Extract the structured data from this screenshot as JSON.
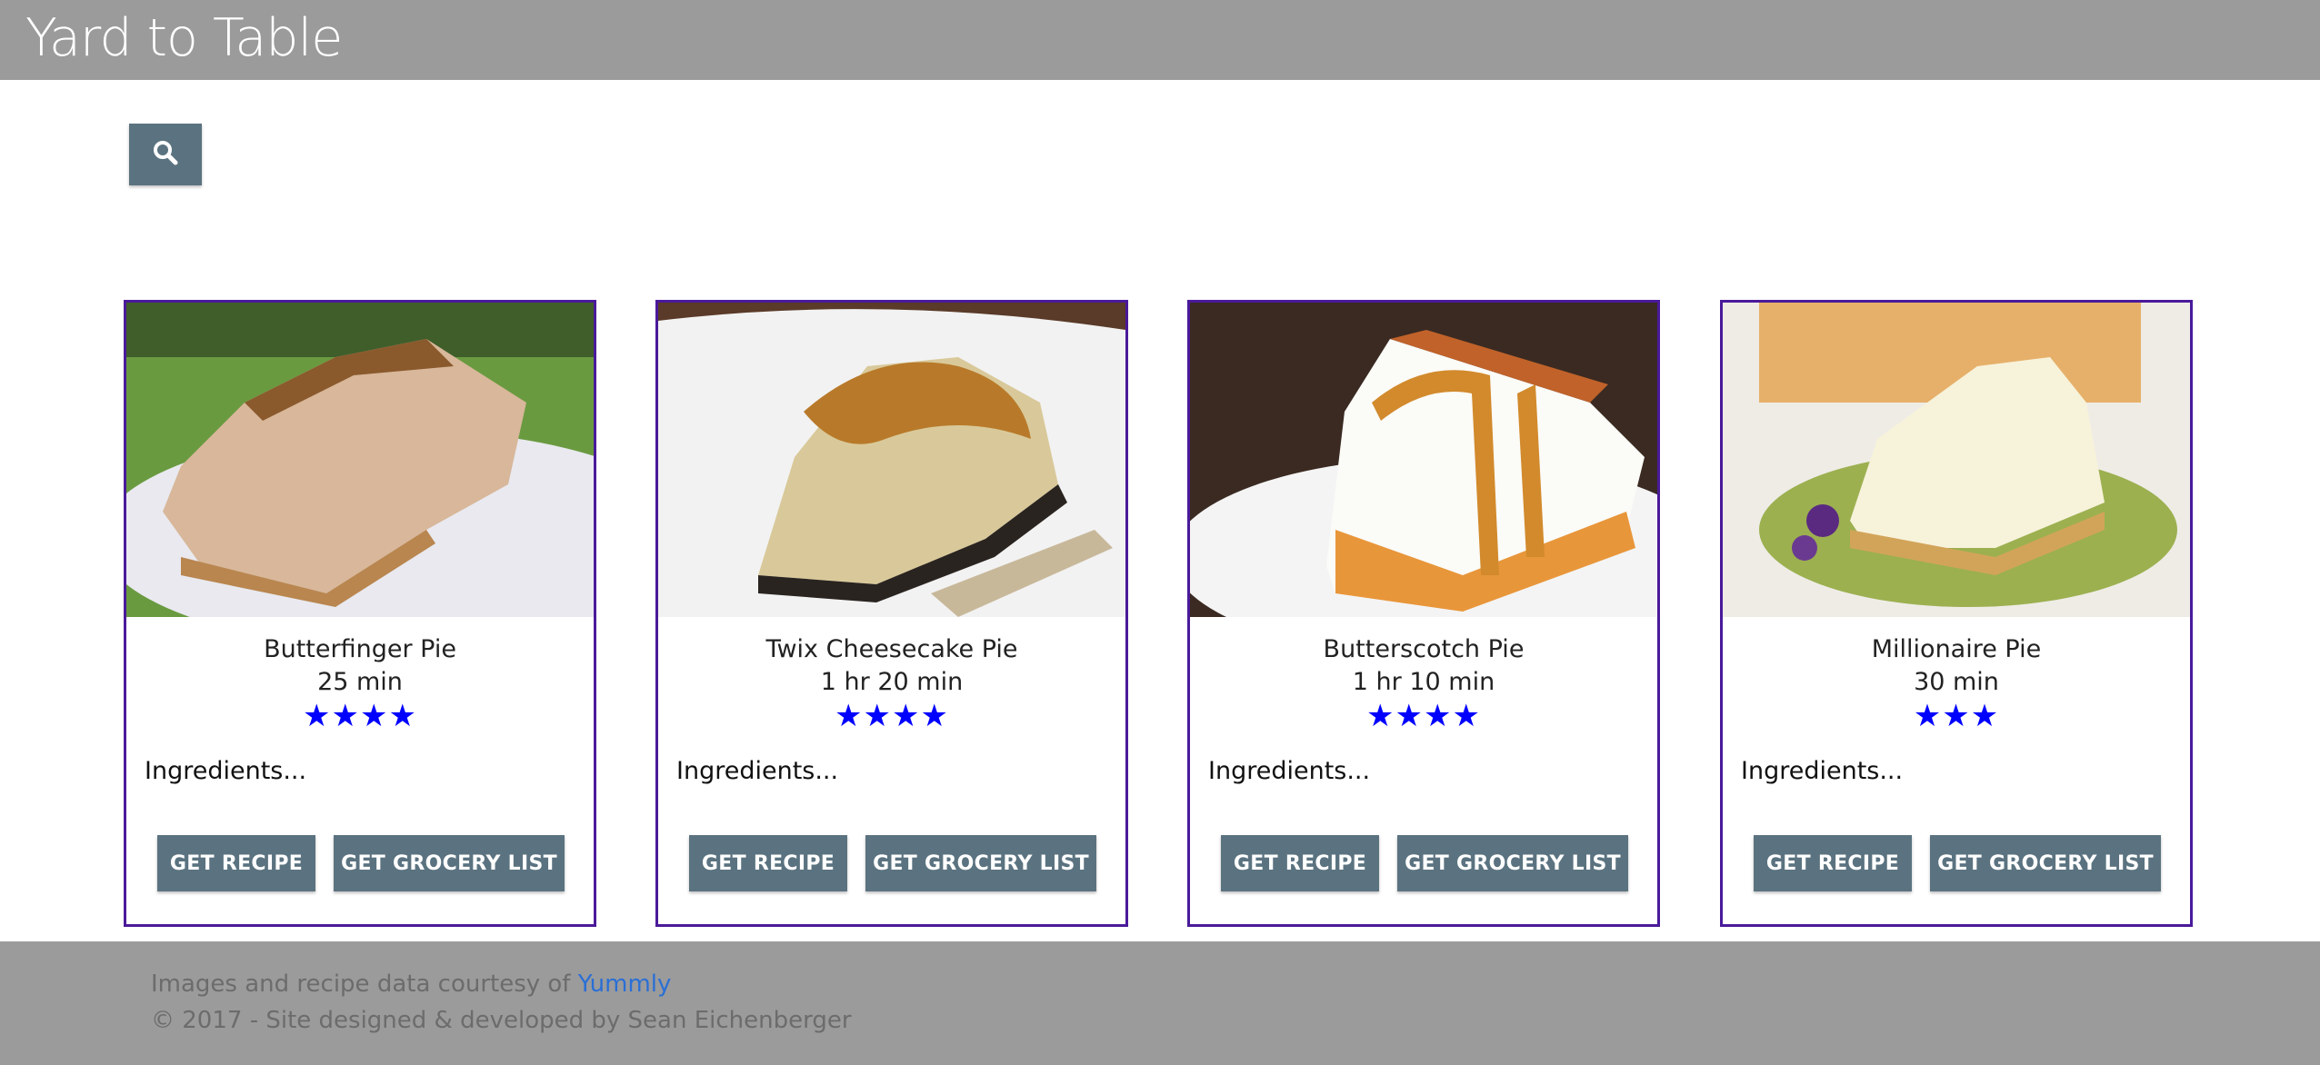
{
  "header": {
    "title": "Yard to Table"
  },
  "search": {
    "icon": "search-icon"
  },
  "recipes": [
    {
      "name": "Butterfinger Pie",
      "time": "25 min",
      "rating": 4,
      "stars": "★★★★",
      "ingredients": "Ingredients...",
      "get_recipe": "GET RECIPE",
      "get_grocery_list": "GET GROCERY LIST"
    },
    {
      "name": "Twix Cheesecake Pie",
      "time": "1 hr 20 min",
      "rating": 4,
      "stars": "★★★★",
      "ingredients": "Ingredients...",
      "get_recipe": "GET RECIPE",
      "get_grocery_list": "GET GROCERY LIST"
    },
    {
      "name": "Butterscotch Pie",
      "time": "1 hr 10 min",
      "rating": 4,
      "stars": "★★★★",
      "ingredients": "Ingredients...",
      "get_recipe": "GET RECIPE",
      "get_grocery_list": "GET GROCERY LIST"
    },
    {
      "name": "Millionaire Pie",
      "time": "30 min",
      "rating": 3,
      "stars": "★★★",
      "ingredients": "Ingredients...",
      "get_recipe": "GET RECIPE",
      "get_grocery_list": "GET GROCERY LIST"
    }
  ],
  "footer": {
    "credit_prefix": "Images and recipe data courtesy of ",
    "credit_link": "Yummly",
    "copyright": "© 2017 - Site designed & developed by Sean Eichenberger"
  },
  "colors": {
    "header_bg": "#9b9b9b",
    "button_bg": "#5b7380",
    "card_border": "#4a1a9a",
    "star": "#0000ff",
    "link": "#2a6fd6"
  }
}
